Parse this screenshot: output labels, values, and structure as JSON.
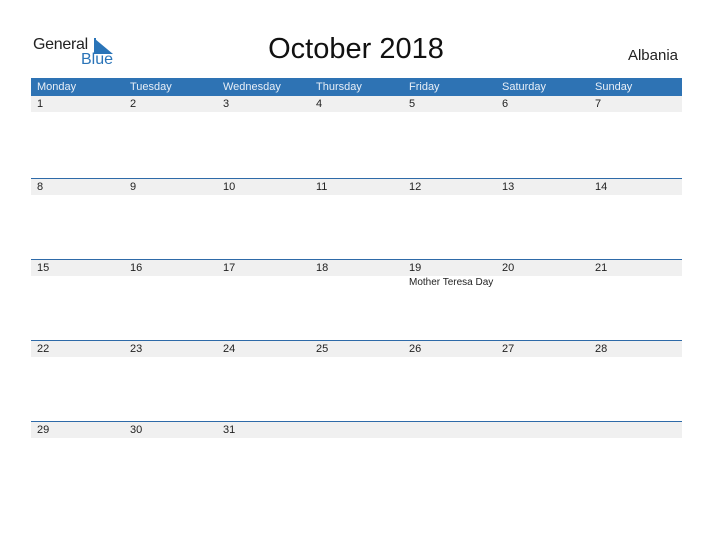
{
  "logo": {
    "line1": "General",
    "line2": "Blue"
  },
  "title": "October 2018",
  "country": "Albania",
  "colors": {
    "header_bg": "#2e73b4",
    "accent": "#2a74b8",
    "row_bg": "#f0f0f0"
  },
  "weekdays": [
    "Monday",
    "Tuesday",
    "Wednesday",
    "Thursday",
    "Friday",
    "Saturday",
    "Sunday"
  ],
  "weeks": [
    {
      "days": [
        "1",
        "2",
        "3",
        "4",
        "5",
        "6",
        "7"
      ],
      "events": [
        "",
        "",
        "",
        "",
        "",
        "",
        ""
      ]
    },
    {
      "days": [
        "8",
        "9",
        "10",
        "11",
        "12",
        "13",
        "14"
      ],
      "events": [
        "",
        "",
        "",
        "",
        "",
        "",
        ""
      ]
    },
    {
      "days": [
        "15",
        "16",
        "17",
        "18",
        "19",
        "20",
        "21"
      ],
      "events": [
        "",
        "",
        "",
        "",
        "Mother Teresa Day",
        "",
        ""
      ]
    },
    {
      "days": [
        "22",
        "23",
        "24",
        "25",
        "26",
        "27",
        "28"
      ],
      "events": [
        "",
        "",
        "",
        "",
        "",
        "",
        ""
      ]
    },
    {
      "days": [
        "29",
        "30",
        "31",
        "",
        "",
        "",
        ""
      ],
      "events": [
        "",
        "",
        "",
        "",
        "",
        "",
        ""
      ]
    }
  ]
}
